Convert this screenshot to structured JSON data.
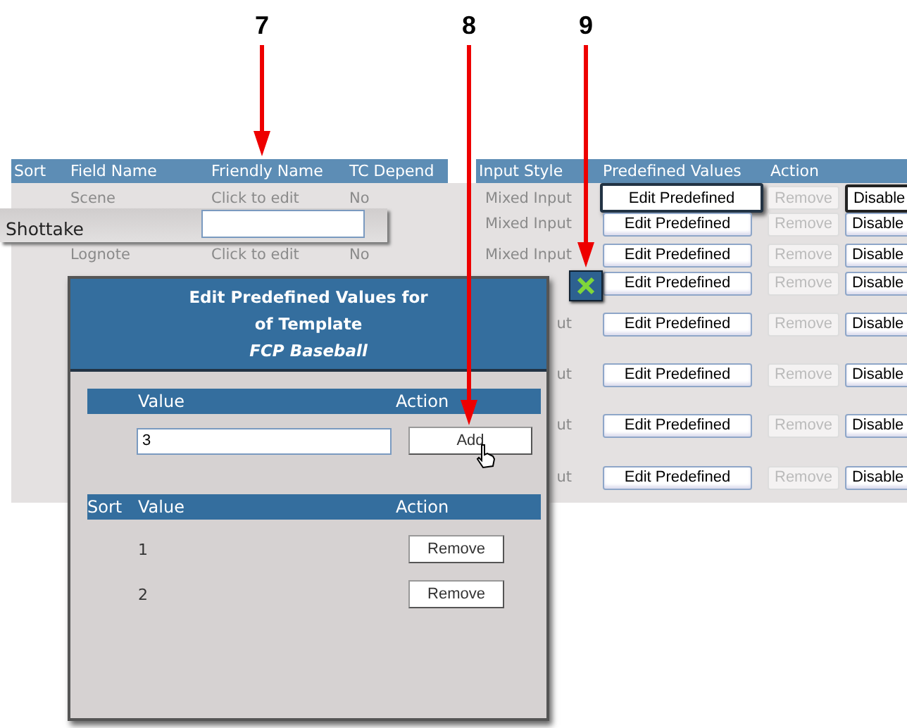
{
  "callouts": [
    {
      "number": "7"
    },
    {
      "number": "8"
    },
    {
      "number": "9"
    }
  ],
  "grid": {
    "columns": [
      "Sort",
      "Field Name",
      "Friendly Name",
      "TC Depend",
      "Input Style",
      "Predefined Values",
      "Action"
    ],
    "rows": [
      {
        "field_name": "Scene",
        "friendly_name": "Click to edit",
        "tc_depend": "No",
        "input_style": "Mixed Input",
        "edit_label": "Edit Predefined",
        "remove_label": "Remove",
        "disable_label": "Disable",
        "highlighted": true,
        "remove_disabled": true
      },
      {
        "input_style": "Mixed Input",
        "edit_label": "Edit Predefined",
        "remove_label": "Remove",
        "disable_label": "Disable",
        "highlighted": false,
        "remove_disabled": true
      },
      {
        "field_name": "Lognote",
        "friendly_name": "Click to edit",
        "tc_depend": "No",
        "input_style": "Mixed Input",
        "edit_label": "Edit Predefined",
        "remove_label": "Remove",
        "disable_label": "Disable",
        "highlighted": false,
        "remove_disabled": true
      },
      {
        "edit_label": "Edit Predefined",
        "remove_label": "Remove",
        "disable_label": "Disable",
        "highlighted": false,
        "remove_disabled": true
      },
      {
        "input_style": "ut",
        "edit_label": "Edit Predefined",
        "remove_label": "Remove",
        "disable_label": "Disable",
        "highlighted": false,
        "remove_disabled": true
      },
      {
        "input_style": "ut",
        "edit_label": "Edit Predefined",
        "remove_label": "Remove",
        "disable_label": "Disable",
        "highlighted": false,
        "remove_disabled": true
      },
      {
        "input_style": "ut",
        "edit_label": "Edit Predefined",
        "remove_label": "Remove",
        "disable_label": "Disable",
        "highlighted": false,
        "remove_disabled": true
      },
      {
        "input_style": "ut",
        "edit_label": "Edit Predefined",
        "remove_label": "Remove",
        "disable_label": "Disable",
        "highlighted": false,
        "remove_disabled": true
      }
    ]
  },
  "inline_editor": {
    "label": "Shottake"
  },
  "dialog": {
    "title_lines": [
      "Edit Predefined Values for",
      "of Template"
    ],
    "template_name": "FCP Baseball",
    "add_columns": [
      "Value",
      "Action"
    ],
    "new_value": "3",
    "add_label": "Add",
    "list_columns": [
      "Sort",
      "Value",
      "Action"
    ],
    "values": [
      {
        "value": "1",
        "remove_label": "Remove"
      },
      {
        "value": "2",
        "remove_label": "Remove"
      }
    ]
  }
}
